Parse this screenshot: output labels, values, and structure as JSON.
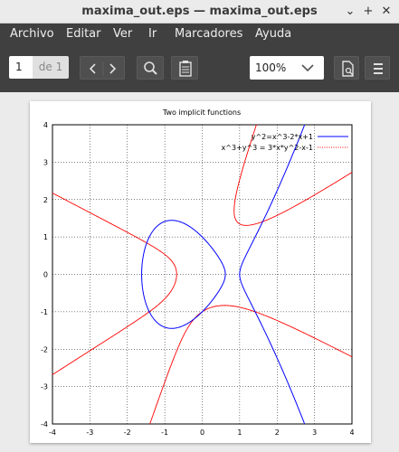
{
  "window": {
    "title": "maxima_out.eps — maxima_out.eps"
  },
  "menu": {
    "items": [
      "Archivo",
      "Editar",
      "Ver",
      "Ir",
      "Marcadores",
      "Ayuda"
    ]
  },
  "toolbar": {
    "page_current": "1",
    "page_of": "de 1",
    "zoom": "100%"
  },
  "chart_data": {
    "type": "line",
    "title": "Two implicit functions",
    "xlim": [
      -4,
      4
    ],
    "ylim": [
      -4,
      4
    ],
    "x_ticks": [
      "-4",
      "-3",
      "-2",
      "-1",
      "0",
      "1",
      "2",
      "3",
      "4"
    ],
    "y_ticks": [
      "4",
      "3",
      "2",
      "1",
      "0",
      "-1",
      "-2",
      "-3",
      "-4"
    ],
    "grid": true,
    "legend_position": "top-right",
    "series": [
      {
        "name": "y^2=x^3-2*x+1",
        "color": "#0000ff",
        "equation": "y^2 = x^3 - 2*x + 1"
      },
      {
        "name": "x^3+y^3 = 3*x*y^2-x-1",
        "color": "#ff0000",
        "equation": "x^3 + y^3 = 3*x*y^2 - x - 1"
      }
    ],
    "legend_labels": [
      "y^2=x^3-2*x+1",
      "x^3+y^3 = 3*x*y^2-x-1"
    ]
  },
  "colors": {
    "menubar": "#404040",
    "series1": "#0000ff",
    "series2": "#ff0000"
  }
}
